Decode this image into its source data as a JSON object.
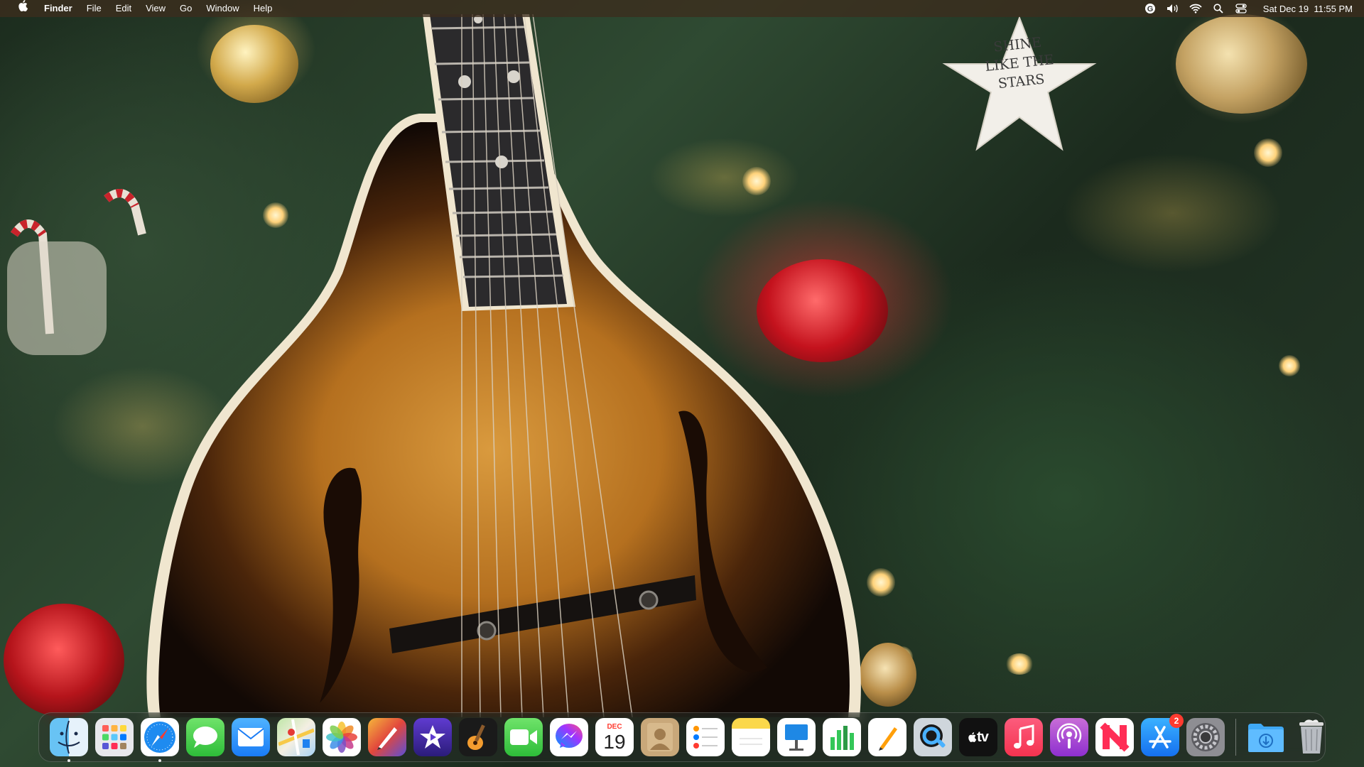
{
  "menubar": {
    "app_name": "Finder",
    "menus": [
      "File",
      "Edit",
      "View",
      "Go",
      "Window",
      "Help"
    ],
    "status": {
      "icons": [
        "grammarly-icon",
        "volume-icon",
        "wifi-icon",
        "spotlight-search-icon",
        "control-center-icon"
      ],
      "clock": "Sat Dec 19  11:55 PM"
    }
  },
  "wallpaper": {
    "ornament_text": "SHINE LIKE THE STARS"
  },
  "dock": {
    "apps": [
      {
        "name": "Finder",
        "icon": "finder-icon",
        "running": true
      },
      {
        "name": "Launchpad",
        "icon": "launchpad-icon",
        "running": false
      },
      {
        "name": "Safari",
        "icon": "safari-icon",
        "running": true
      },
      {
        "name": "Messages",
        "icon": "messages-icon",
        "running": false
      },
      {
        "name": "Mail",
        "icon": "mail-icon",
        "running": false
      },
      {
        "name": "Maps",
        "icon": "maps-icon",
        "running": false
      },
      {
        "name": "Photos",
        "icon": "photos-icon",
        "running": false
      },
      {
        "name": "Pixelmator Pro",
        "icon": "pixelmator-icon",
        "running": false
      },
      {
        "name": "iMovie",
        "icon": "imovie-icon",
        "running": false
      },
      {
        "name": "GarageBand",
        "icon": "garageband-icon",
        "running": false
      },
      {
        "name": "FaceTime",
        "icon": "facetime-icon",
        "running": false
      },
      {
        "name": "Messenger",
        "icon": "messenger-icon",
        "running": false
      },
      {
        "name": "Calendar",
        "icon": "calendar-icon",
        "running": false,
        "month": "DEC",
        "day": "19"
      },
      {
        "name": "Contacts",
        "icon": "contacts-icon",
        "running": false
      },
      {
        "name": "Reminders",
        "icon": "reminders-icon",
        "running": false
      },
      {
        "name": "Notes",
        "icon": "notes-icon",
        "running": false
      },
      {
        "name": "Keynote",
        "icon": "keynote-icon",
        "running": false
      },
      {
        "name": "Numbers",
        "icon": "numbers-icon",
        "running": false
      },
      {
        "name": "Pages",
        "icon": "pages-icon",
        "running": false
      },
      {
        "name": "QuickTime Player",
        "icon": "quicktime-icon",
        "running": false
      },
      {
        "name": "TV",
        "icon": "apple-tv-icon",
        "running": false,
        "label": "tv"
      },
      {
        "name": "Music",
        "icon": "music-icon",
        "running": false
      },
      {
        "name": "Podcasts",
        "icon": "podcasts-icon",
        "running": false
      },
      {
        "name": "News",
        "icon": "news-icon",
        "running": false
      },
      {
        "name": "App Store",
        "icon": "app-store-icon",
        "running": false,
        "badge": "2"
      },
      {
        "name": "System Preferences",
        "icon": "system-preferences-icon",
        "running": false
      }
    ],
    "folders": [
      {
        "name": "Downloads",
        "icon": "downloads-folder-icon"
      },
      {
        "name": "Trash",
        "icon": "trash-icon"
      }
    ]
  }
}
